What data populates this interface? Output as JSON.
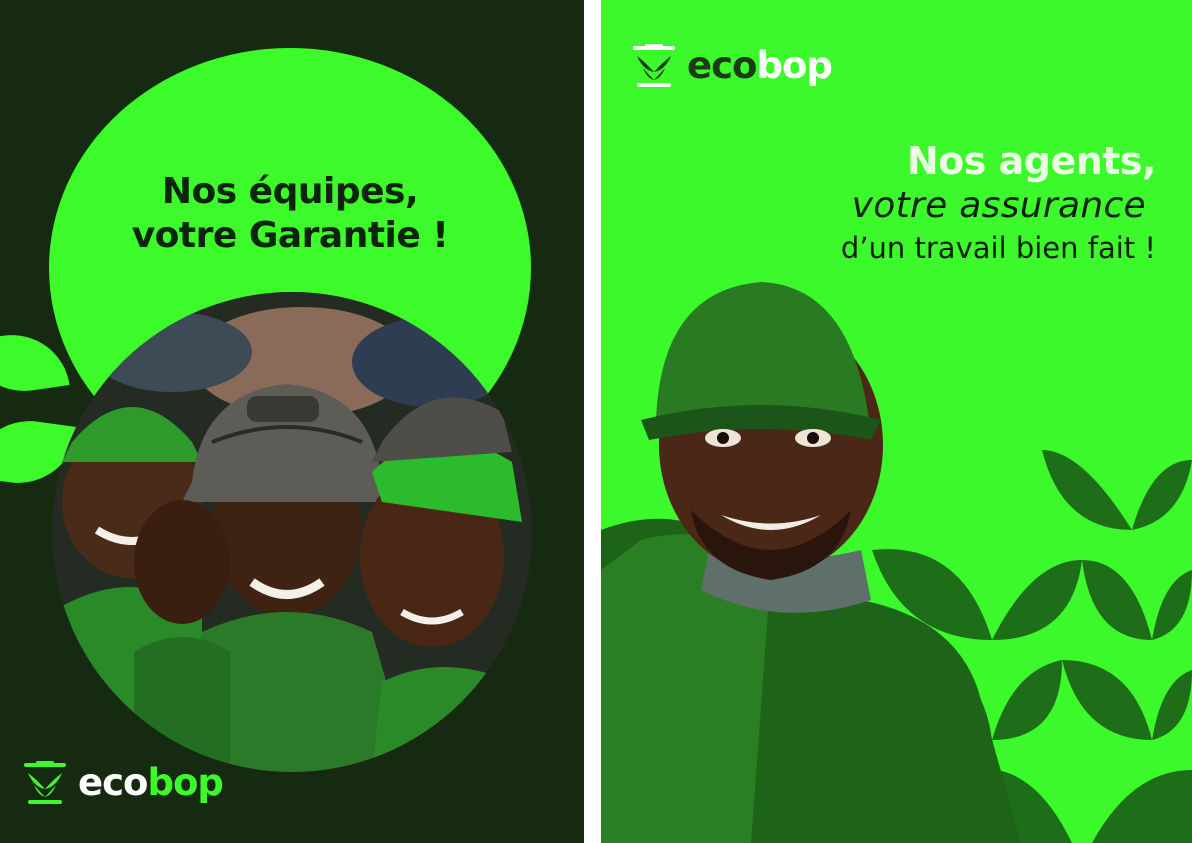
{
  "left_poster": {
    "headline_line1": "Nos équipes,",
    "headline_line2": "votre Garantie !",
    "logo_part1": "eco",
    "logo_part2": "bop",
    "background_color": "#162a12",
    "accent_color": "#3dfa2a"
  },
  "right_poster": {
    "logo_part1": "eco",
    "logo_part2": "bop",
    "tagline_line1": "Nos agents,",
    "tagline_line2": "votre assurance",
    "tagline_line3": "d’un travail bien fait !",
    "background_color": "#3cf92b",
    "leaf_color": "#1e6e19"
  },
  "icons": {
    "logo_mark": "leaf-pot-icon",
    "decor": "leaf-icon"
  }
}
